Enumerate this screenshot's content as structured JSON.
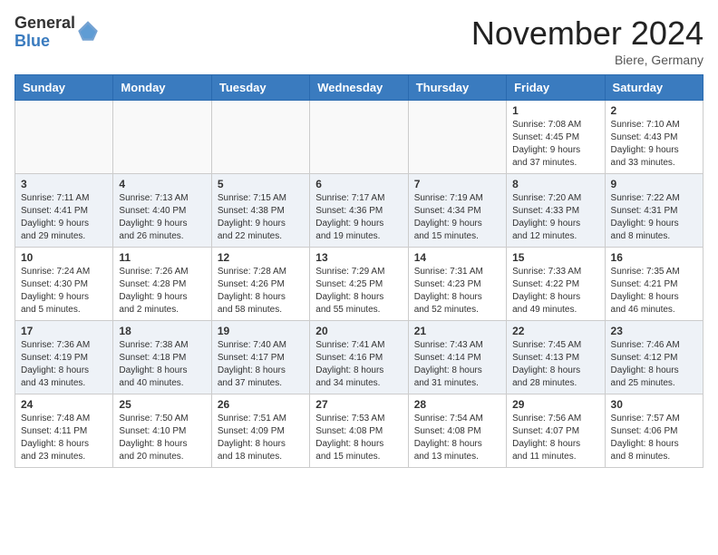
{
  "header": {
    "logo_general": "General",
    "logo_blue": "Blue",
    "month_title": "November 2024",
    "location": "Biere, Germany"
  },
  "days_of_week": [
    "Sunday",
    "Monday",
    "Tuesday",
    "Wednesday",
    "Thursday",
    "Friday",
    "Saturday"
  ],
  "weeks": [
    [
      {
        "day": "",
        "info": ""
      },
      {
        "day": "",
        "info": ""
      },
      {
        "day": "",
        "info": ""
      },
      {
        "day": "",
        "info": ""
      },
      {
        "day": "",
        "info": ""
      },
      {
        "day": "1",
        "info": "Sunrise: 7:08 AM\nSunset: 4:45 PM\nDaylight: 9 hours\nand 37 minutes."
      },
      {
        "day": "2",
        "info": "Sunrise: 7:10 AM\nSunset: 4:43 PM\nDaylight: 9 hours\nand 33 minutes."
      }
    ],
    [
      {
        "day": "3",
        "info": "Sunrise: 7:11 AM\nSunset: 4:41 PM\nDaylight: 9 hours\nand 29 minutes."
      },
      {
        "day": "4",
        "info": "Sunrise: 7:13 AM\nSunset: 4:40 PM\nDaylight: 9 hours\nand 26 minutes."
      },
      {
        "day": "5",
        "info": "Sunrise: 7:15 AM\nSunset: 4:38 PM\nDaylight: 9 hours\nand 22 minutes."
      },
      {
        "day": "6",
        "info": "Sunrise: 7:17 AM\nSunset: 4:36 PM\nDaylight: 9 hours\nand 19 minutes."
      },
      {
        "day": "7",
        "info": "Sunrise: 7:19 AM\nSunset: 4:34 PM\nDaylight: 9 hours\nand 15 minutes."
      },
      {
        "day": "8",
        "info": "Sunrise: 7:20 AM\nSunset: 4:33 PM\nDaylight: 9 hours\nand 12 minutes."
      },
      {
        "day": "9",
        "info": "Sunrise: 7:22 AM\nSunset: 4:31 PM\nDaylight: 9 hours\nand 8 minutes."
      }
    ],
    [
      {
        "day": "10",
        "info": "Sunrise: 7:24 AM\nSunset: 4:30 PM\nDaylight: 9 hours\nand 5 minutes."
      },
      {
        "day": "11",
        "info": "Sunrise: 7:26 AM\nSunset: 4:28 PM\nDaylight: 9 hours\nand 2 minutes."
      },
      {
        "day": "12",
        "info": "Sunrise: 7:28 AM\nSunset: 4:26 PM\nDaylight: 8 hours\nand 58 minutes."
      },
      {
        "day": "13",
        "info": "Sunrise: 7:29 AM\nSunset: 4:25 PM\nDaylight: 8 hours\nand 55 minutes."
      },
      {
        "day": "14",
        "info": "Sunrise: 7:31 AM\nSunset: 4:23 PM\nDaylight: 8 hours\nand 52 minutes."
      },
      {
        "day": "15",
        "info": "Sunrise: 7:33 AM\nSunset: 4:22 PM\nDaylight: 8 hours\nand 49 minutes."
      },
      {
        "day": "16",
        "info": "Sunrise: 7:35 AM\nSunset: 4:21 PM\nDaylight: 8 hours\nand 46 minutes."
      }
    ],
    [
      {
        "day": "17",
        "info": "Sunrise: 7:36 AM\nSunset: 4:19 PM\nDaylight: 8 hours\nand 43 minutes."
      },
      {
        "day": "18",
        "info": "Sunrise: 7:38 AM\nSunset: 4:18 PM\nDaylight: 8 hours\nand 40 minutes."
      },
      {
        "day": "19",
        "info": "Sunrise: 7:40 AM\nSunset: 4:17 PM\nDaylight: 8 hours\nand 37 minutes."
      },
      {
        "day": "20",
        "info": "Sunrise: 7:41 AM\nSunset: 4:16 PM\nDaylight: 8 hours\nand 34 minutes."
      },
      {
        "day": "21",
        "info": "Sunrise: 7:43 AM\nSunset: 4:14 PM\nDaylight: 8 hours\nand 31 minutes."
      },
      {
        "day": "22",
        "info": "Sunrise: 7:45 AM\nSunset: 4:13 PM\nDaylight: 8 hours\nand 28 minutes."
      },
      {
        "day": "23",
        "info": "Sunrise: 7:46 AM\nSunset: 4:12 PM\nDaylight: 8 hours\nand 25 minutes."
      }
    ],
    [
      {
        "day": "24",
        "info": "Sunrise: 7:48 AM\nSunset: 4:11 PM\nDaylight: 8 hours\nand 23 minutes."
      },
      {
        "day": "25",
        "info": "Sunrise: 7:50 AM\nSunset: 4:10 PM\nDaylight: 8 hours\nand 20 minutes."
      },
      {
        "day": "26",
        "info": "Sunrise: 7:51 AM\nSunset: 4:09 PM\nDaylight: 8 hours\nand 18 minutes."
      },
      {
        "day": "27",
        "info": "Sunrise: 7:53 AM\nSunset: 4:08 PM\nDaylight: 8 hours\nand 15 minutes."
      },
      {
        "day": "28",
        "info": "Sunrise: 7:54 AM\nSunset: 4:08 PM\nDaylight: 8 hours\nand 13 minutes."
      },
      {
        "day": "29",
        "info": "Sunrise: 7:56 AM\nSunset: 4:07 PM\nDaylight: 8 hours\nand 11 minutes."
      },
      {
        "day": "30",
        "info": "Sunrise: 7:57 AM\nSunset: 4:06 PM\nDaylight: 8 hours\nand 8 minutes."
      }
    ]
  ]
}
